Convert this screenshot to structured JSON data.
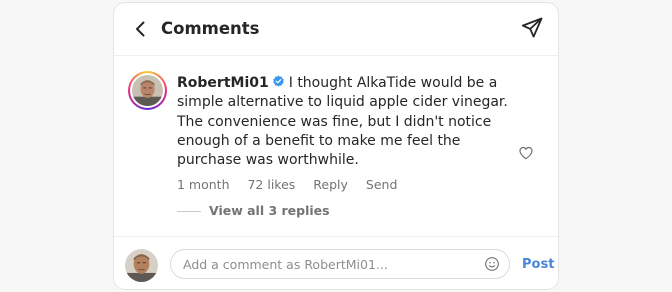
{
  "header": {
    "title": "Comments",
    "back_icon": "chevron-left-icon",
    "share_icon": "paper-plane-icon"
  },
  "comment": {
    "username": "RobertMi01",
    "verified": true,
    "text": "I thought AlkaTide would be a simple alternative to liquid apple cider vinegar. The convenience was fine, but I didn't notice enough of a benefit to make me feel the purchase was worthwhile.",
    "time": "1 month",
    "likes": "72 likes",
    "reply_label": "Reply",
    "send_label": "Send",
    "view_replies": "View all 3 replies",
    "like_icon": "heart-outline-icon"
  },
  "composer": {
    "placeholder": "Add a comment as RobertMi01...",
    "value": "",
    "emoji_icon": "smiley-icon",
    "post_label": "Post"
  },
  "colors": {
    "accent": "#4a86d6",
    "verified": "#3897f0",
    "muted_text": "#737373",
    "text": "#262626",
    "border": "#dbdbdb"
  }
}
